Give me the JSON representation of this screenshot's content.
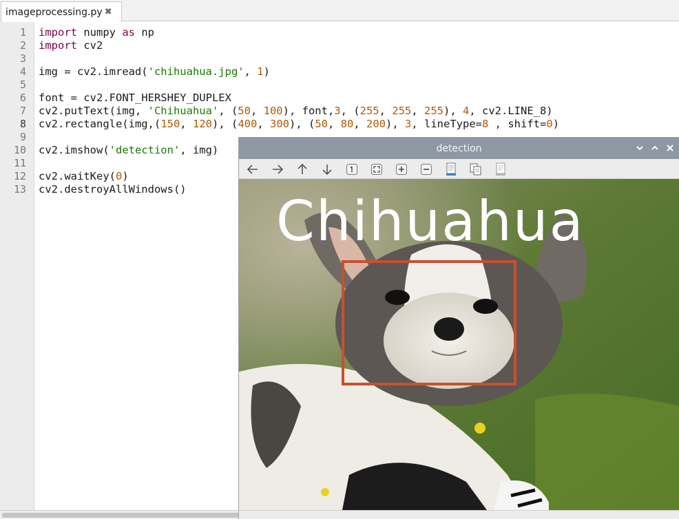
{
  "editor": {
    "tab": {
      "label": "imageprocessing.py",
      "close_icon": "close-icon"
    },
    "current_line": 8,
    "lines": [
      {
        "n": "1",
        "parts": [
          {
            "t": "import",
            "c": "kw"
          },
          {
            "t": " numpy "
          },
          {
            "t": "as",
            "c": "kw"
          },
          {
            "t": " np"
          }
        ]
      },
      {
        "n": "2",
        "parts": [
          {
            "t": "import",
            "c": "kw"
          },
          {
            "t": " cv2"
          }
        ]
      },
      {
        "n": "3",
        "parts": []
      },
      {
        "n": "4",
        "parts": [
          {
            "t": "img = cv2.imread("
          },
          {
            "t": "'chihuahua.jpg'",
            "c": "str"
          },
          {
            "t": ", "
          },
          {
            "t": "1",
            "c": "num"
          },
          {
            "t": ")"
          }
        ]
      },
      {
        "n": "5",
        "parts": []
      },
      {
        "n": "6",
        "parts": [
          {
            "t": "font = cv2.FONT_HERSHEY_DUPLEX"
          }
        ]
      },
      {
        "n": "7",
        "parts": [
          {
            "t": "cv2.putText(img, "
          },
          {
            "t": "'Chihuahua'",
            "c": "str"
          },
          {
            "t": ", ("
          },
          {
            "t": "50",
            "c": "num"
          },
          {
            "t": ", "
          },
          {
            "t": "100",
            "c": "num"
          },
          {
            "t": "), font,"
          },
          {
            "t": "3",
            "c": "num"
          },
          {
            "t": ", ("
          },
          {
            "t": "255",
            "c": "num"
          },
          {
            "t": ", "
          },
          {
            "t": "255",
            "c": "num"
          },
          {
            "t": ", "
          },
          {
            "t": "255",
            "c": "num"
          },
          {
            "t": "), "
          },
          {
            "t": "4",
            "c": "num"
          },
          {
            "t": ", cv2.LINE_8)"
          }
        ]
      },
      {
        "n": "8",
        "parts": [
          {
            "t": "cv2.rectangle(img,("
          },
          {
            "t": "150",
            "c": "num"
          },
          {
            "t": ", "
          },
          {
            "t": "120",
            "c": "num"
          },
          {
            "t": "), ("
          },
          {
            "t": "400",
            "c": "num"
          },
          {
            "t": ", "
          },
          {
            "t": "300",
            "c": "num"
          },
          {
            "t": "), ("
          },
          {
            "t": "50",
            "c": "num"
          },
          {
            "t": ", "
          },
          {
            "t": "80",
            "c": "num"
          },
          {
            "t": ", "
          },
          {
            "t": "200",
            "c": "num"
          },
          {
            "t": "), "
          },
          {
            "t": "3",
            "c": "num"
          },
          {
            "t": ", lineType="
          },
          {
            "t": "8",
            "c": "num"
          },
          {
            "t": " , shift="
          },
          {
            "t": "0",
            "c": "num"
          },
          {
            "t": ")"
          }
        ]
      },
      {
        "n": "9",
        "parts": []
      },
      {
        "n": "10",
        "parts": [
          {
            "t": "cv2.imshow("
          },
          {
            "t": "'detection'",
            "c": "str"
          },
          {
            "t": ", img)"
          }
        ]
      },
      {
        "n": "11",
        "parts": []
      },
      {
        "n": "12",
        "parts": [
          {
            "t": "cv2.waitKey("
          },
          {
            "t": "0",
            "c": "num"
          },
          {
            "t": ")"
          }
        ]
      },
      {
        "n": "13",
        "parts": [
          {
            "t": "cv2.destroyAllWindows()"
          }
        ]
      }
    ]
  },
  "image_window": {
    "title": "detection",
    "window_buttons": [
      "chevron-down-icon",
      "chevron-up-icon",
      "close-icon"
    ],
    "toolbar": [
      "arrow-left-icon",
      "arrow-right-icon",
      "arrow-up-icon",
      "arrow-down-icon",
      "zoom-original-icon",
      "zoom-fit-icon",
      "zoom-in-icon",
      "zoom-out-icon",
      "save-image-icon",
      "copy-image-icon",
      "properties-icon"
    ],
    "overlay_text": "Chihuahua",
    "colors": {
      "overlay_text": "#ffffff",
      "rectangle": "#c8502e",
      "titlebar": "#8e98a2"
    }
  },
  "colors": {
    "keyword": "#7a0050",
    "string": "#1a7a00",
    "number": "#b35800"
  }
}
